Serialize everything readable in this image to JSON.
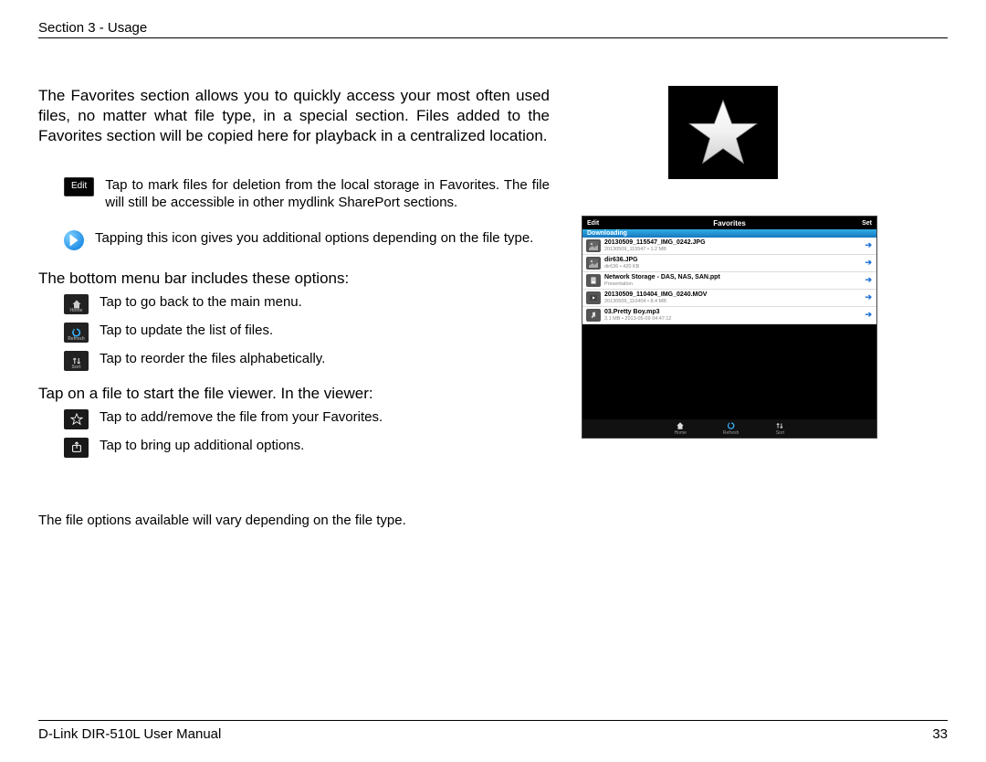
{
  "header": {
    "section": "Section 3 - Usage"
  },
  "intro": "The Favorites section allows you to quickly access your most often used files, no matter what file type, in a special section. Files added to the Favorites section will be copied here for playback in a centralized location.",
  "top_icons": [
    {
      "id": "edit",
      "label": "Edit",
      "text": "Tap to mark files for deletion from the local storage in Favorites. The file will still be accessible in other mydlink SharePort sections."
    },
    {
      "id": "more",
      "label": "",
      "text": "Tapping this icon gives you additional options depending on the file type."
    }
  ],
  "menu_heading": "The bottom menu bar includes these options:",
  "menu_items": [
    {
      "id": "home",
      "label": "Home",
      "text": "Tap to go back to the main menu."
    },
    {
      "id": "refresh",
      "label": "Refresh",
      "text": "Tap to update the list of files."
    },
    {
      "id": "sort",
      "label": "Sort",
      "text": "Tap to reorder the files alphabetically."
    }
  ],
  "viewer_heading": "Tap on a file to start the file viewer. In the viewer:",
  "viewer_items": [
    {
      "id": "star",
      "text": "Tap to add/remove the file from your Favorites."
    },
    {
      "id": "share",
      "text": "Tap to bring up additional options."
    }
  ],
  "note": "The file options available will vary depending on the file type.",
  "screenshot": {
    "title": "Favorites",
    "left_btn": "Edit",
    "right_btn": "Set",
    "section": "Downloading",
    "files": [
      {
        "name": "20130509_115547_IMG_0242.JPG",
        "sub": "20130509_115547 • 1.2 MB",
        "type": "image"
      },
      {
        "name": "dir636.JPG",
        "sub": "dir636 • 420 KB",
        "type": "image"
      },
      {
        "name": "Network Storage - DAS, NAS, SAN.ppt",
        "sub": "Presentation",
        "type": "doc"
      },
      {
        "name": "20130509_110404_IMG_0240.MOV",
        "sub": "20130509_110404 • 8.4 MB",
        "type": "video"
      },
      {
        "name": "03.Pretty Boy.mp3",
        "sub": "3.1 MB • 2013-05-09 04:47:12",
        "type": "music"
      }
    ],
    "bottom": [
      {
        "id": "home",
        "label": "Home"
      },
      {
        "id": "refresh",
        "label": "Refresh"
      },
      {
        "id": "sort",
        "label": "Sort"
      }
    ]
  },
  "footer": {
    "manual": "D-Link DIR-510L User Manual",
    "page": "33"
  }
}
